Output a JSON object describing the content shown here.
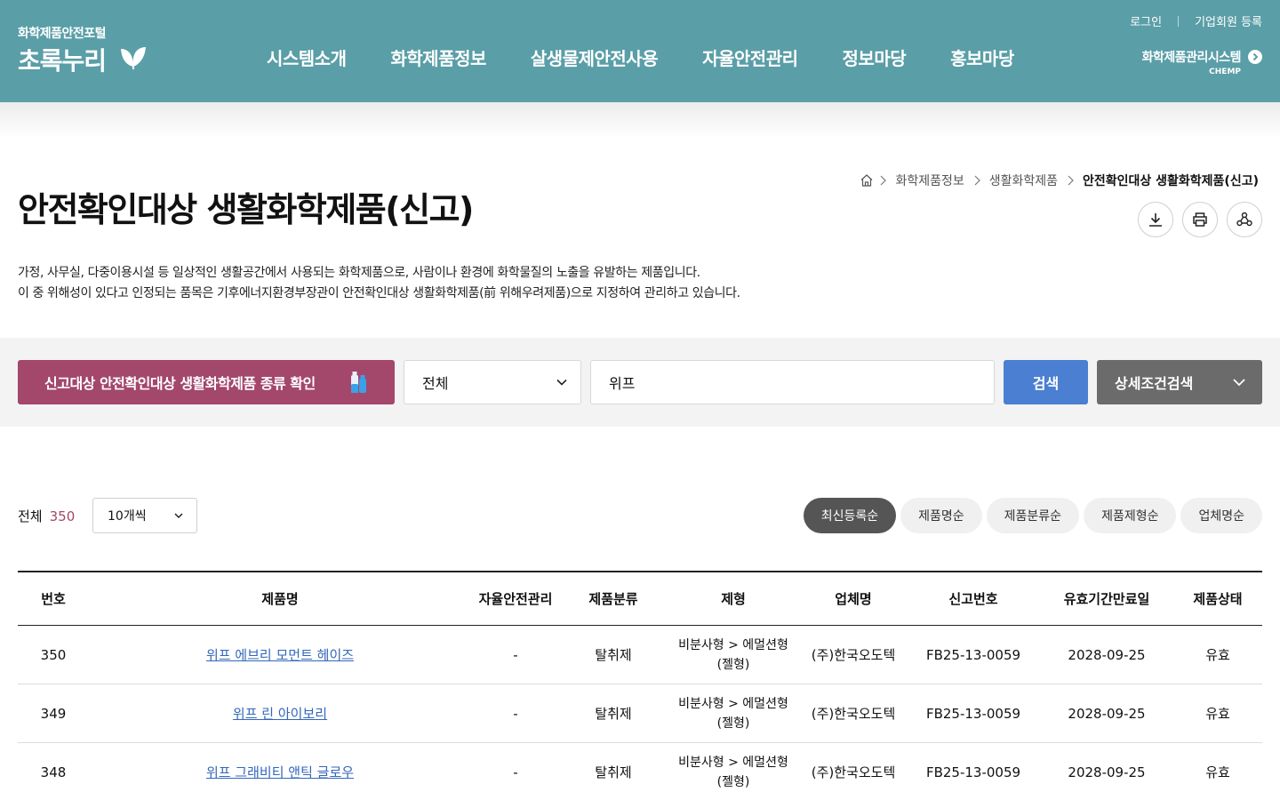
{
  "header": {
    "logo_sub": "화학제품안전포털",
    "logo_main": "초록누리",
    "nav": [
      "시스템소개",
      "화학제품정보",
      "살생물제안전사용",
      "자율안전관리",
      "정보마당",
      "홍보마당"
    ],
    "util": {
      "login": "로그인",
      "register": "기업회원 등록"
    },
    "system_link": "화학제품관리시스템",
    "system_tag": "CHEMP"
  },
  "page": {
    "title": "안전확인대상 생활화학제품(신고)",
    "breadcrumb": [
      "화학제품정보",
      "생활화학제품",
      "안전확인대상 생활화학제품(신고)"
    ],
    "description": [
      "가정, 사무실, 다중이용시설 등 일상적인 생활공간에서 사용되는 화학제품으로, 사람이나 환경에 화학물질의 노출을 유발하는 제품입니다.",
      "이 중 위해성이 있다고 인정되는 품목은 기후에너지환경부장관이 안전확인대상 생활화학제품(前 위해우려제품)으로 지정하여 관리하고 있습니다."
    ]
  },
  "search": {
    "type_button": "신고대상 안전확인대상 생활화학제품 종류 확인",
    "scope_selected": "전체",
    "query": "위프",
    "search_button": "검색",
    "detail_button": "상세조건검색"
  },
  "list": {
    "total_label": "전체",
    "total_count": "350",
    "per_page": "10개씩",
    "sorts": [
      "최신등록순",
      "제품명순",
      "제품분류순",
      "제품제형순",
      "업체명순"
    ],
    "active_sort": "최신등록순"
  },
  "table": {
    "headers": [
      "번호",
      "제품명",
      "자율안전관리",
      "제품분류",
      "제형",
      "업체명",
      "신고번호",
      "유효기간만료일",
      "제품상태"
    ],
    "rows": [
      {
        "no": "350",
        "name": "위프 에브리 모먼트 헤이즈",
        "self": "-",
        "category": "탈취제",
        "form1": "비분사형 > 에멀션형",
        "form2": "(젤형)",
        "company": "(주)한국오도텍",
        "report_no": "FB25-13-0059",
        "expiry": "2028-09-25",
        "status": "유효"
      },
      {
        "no": "349",
        "name": "위프 린 아이보리",
        "self": "-",
        "category": "탈취제",
        "form1": "비분사형 > 에멀션형",
        "form2": "(젤형)",
        "company": "(주)한국오도텍",
        "report_no": "FB25-13-0059",
        "expiry": "2028-09-25",
        "status": "유효"
      },
      {
        "no": "348",
        "name": "위프 그래비티 앤틱 글로우",
        "self": "-",
        "category": "탈취제",
        "form1": "비분사형 > 에멀션형",
        "form2": "(젤형)",
        "company": "(주)한국오도텍",
        "report_no": "FB25-13-0059",
        "expiry": "2028-09-25",
        "status": "유효"
      }
    ]
  },
  "colors": {
    "header_bg": "#5a9ea7",
    "type_button_bg": "#a3476b",
    "search_button_bg": "#4a7fd1",
    "detail_button_bg": "#6b6b6b",
    "count_color": "#a3476b",
    "link_color": "#3366bb"
  },
  "icons": [
    "leaf-icon",
    "chevron-right-circle-icon",
    "home-icon",
    "chevron-right-icon",
    "download-icon",
    "print-icon",
    "share-icon",
    "bottle-icon",
    "chevron-down-icon"
  ]
}
